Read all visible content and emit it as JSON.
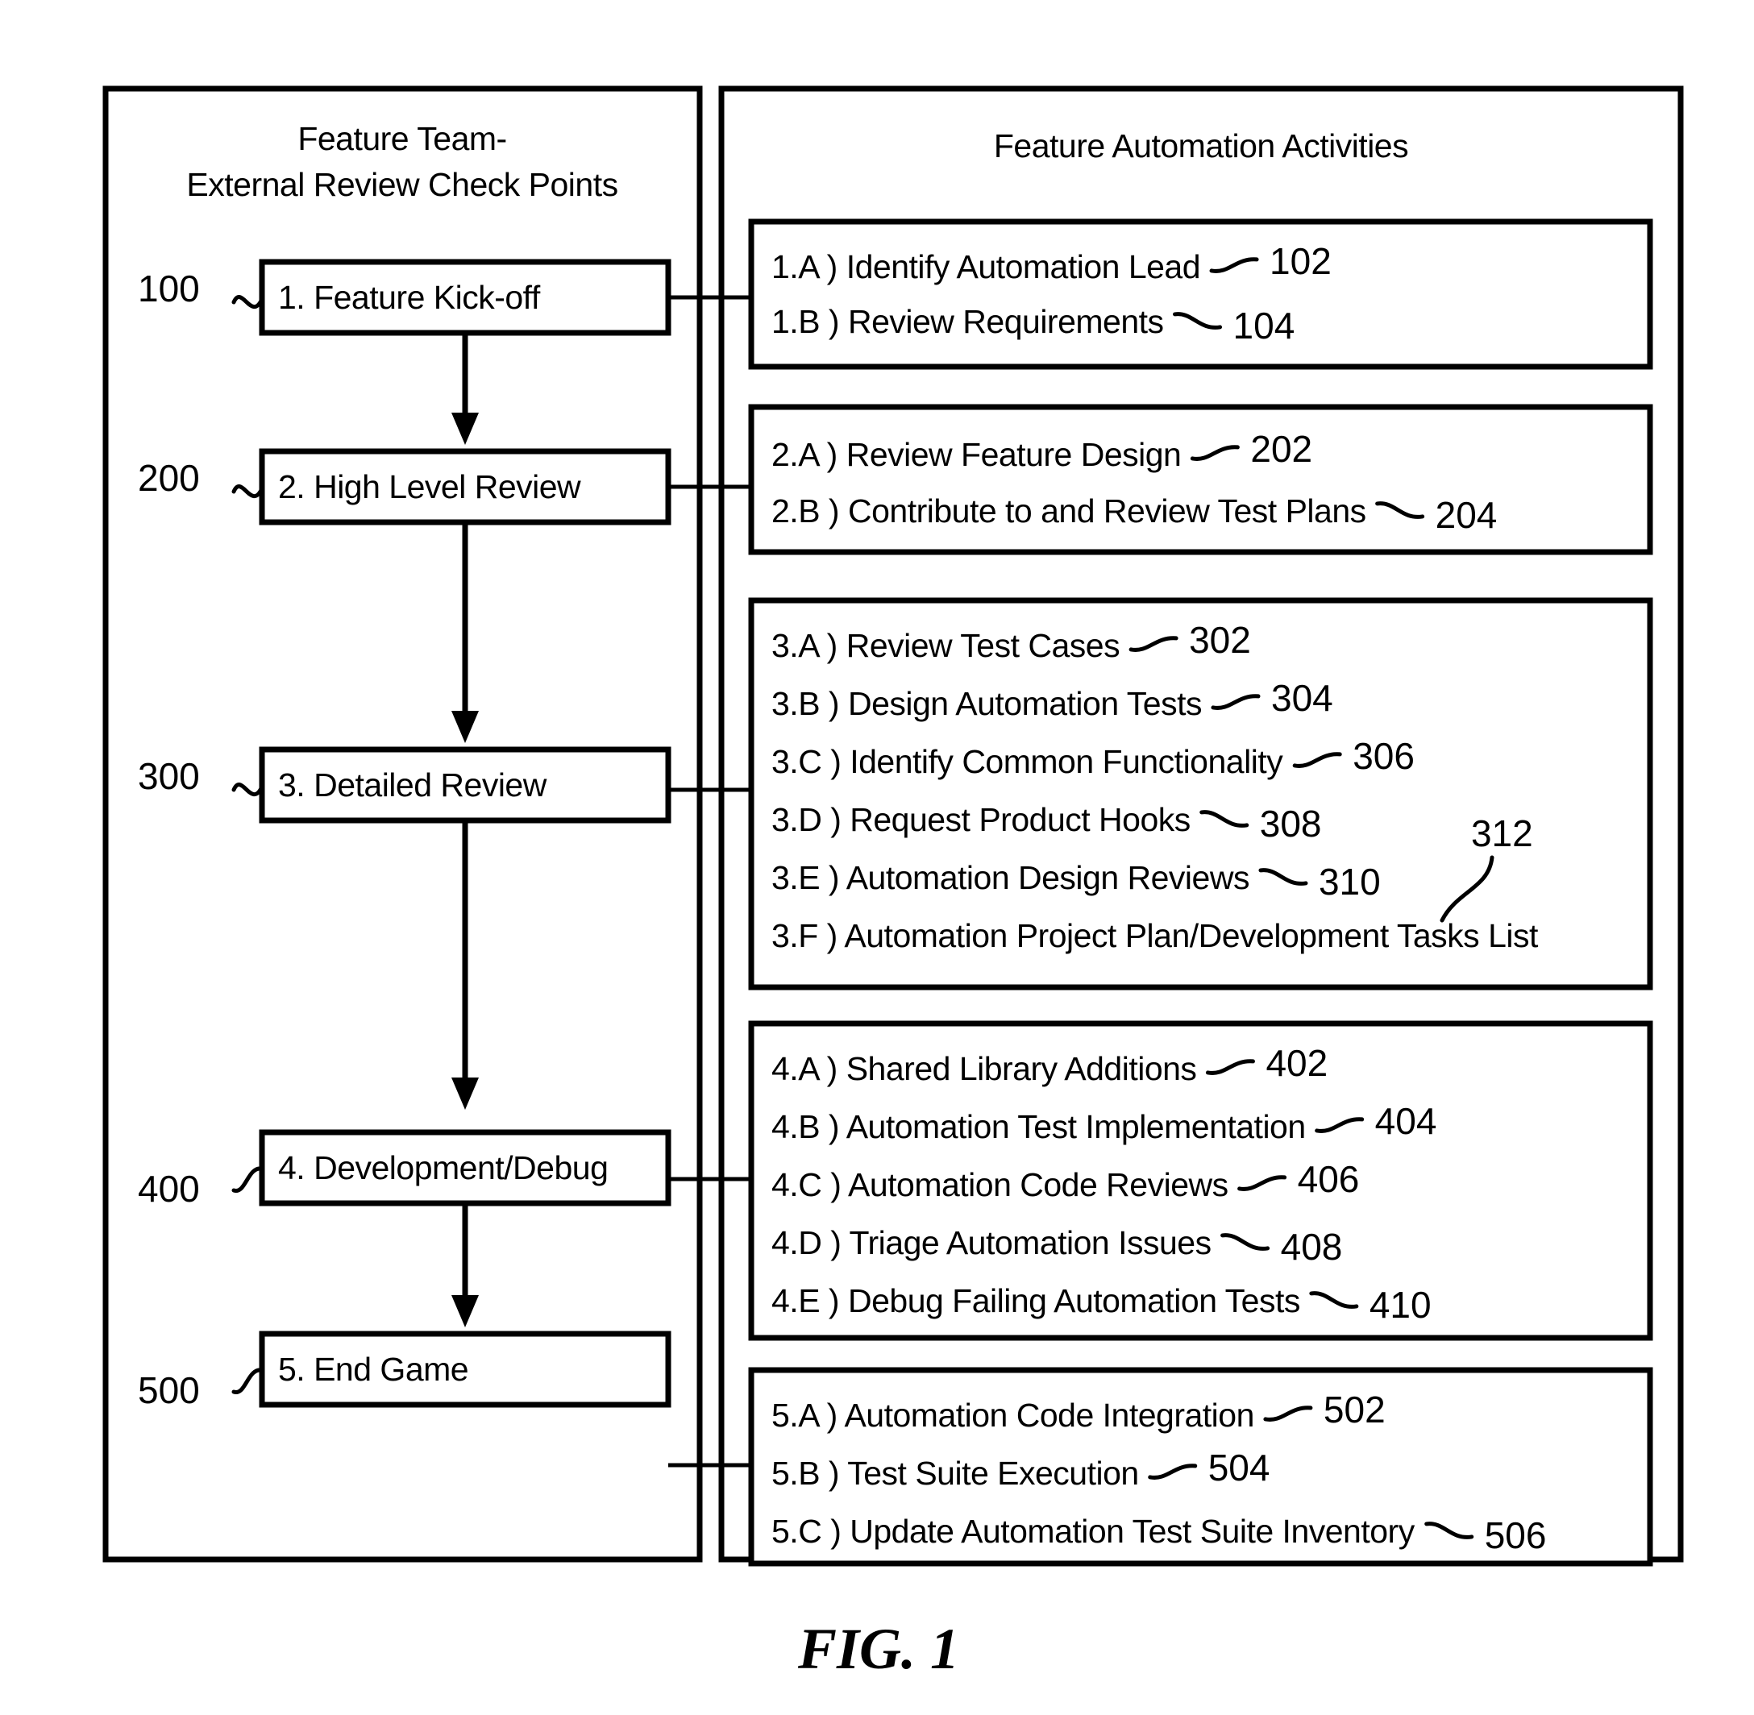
{
  "figure": {
    "caption": "FIG. 1"
  },
  "left_panel": {
    "title_line1": "Feature Team-",
    "title_line2": "External Review Check Points",
    "steps": [
      {
        "ref": "100",
        "label": "1. Feature Kick-off"
      },
      {
        "ref": "200",
        "label": "2. High Level Review"
      },
      {
        "ref": "300",
        "label": "3. Detailed Review"
      },
      {
        "ref": "400",
        "label": "4. Development/Debug"
      },
      {
        "ref": "500",
        "label": "5. End Game"
      }
    ]
  },
  "right_panel": {
    "title": "Feature Automation Activities",
    "groups": [
      {
        "group_id": "1",
        "items": [
          {
            "label": "1.A ) Identify Automation Lead",
            "ref": "102"
          },
          {
            "label": "1.B ) Review Requirements",
            "ref": "104"
          }
        ]
      },
      {
        "group_id": "2",
        "items": [
          {
            "label": "2.A ) Review Feature Design",
            "ref": "202"
          },
          {
            "label": "2.B ) Contribute to and Review Test Plans",
            "ref": "204"
          }
        ]
      },
      {
        "group_id": "3",
        "items": [
          {
            "label": "3.A ) Review Test Cases",
            "ref": "302"
          },
          {
            "label": "3.B ) Design Automation Tests",
            "ref": "304"
          },
          {
            "label": "3.C ) Identify Common Functionality",
            "ref": "306"
          },
          {
            "label": "3.D ) Request Product Hooks",
            "ref": "308"
          },
          {
            "label": "3.E ) Automation Design Reviews",
            "ref": "310"
          },
          {
            "label": "3.F ) Automation Project Plan/Development Tasks List",
            "ref": "312"
          }
        ]
      },
      {
        "group_id": "4",
        "items": [
          {
            "label": "4.A ) Shared Library Additions",
            "ref": "402"
          },
          {
            "label": "4.B ) Automation Test Implementation",
            "ref": "404"
          },
          {
            "label": "4.C ) Automation Code Reviews",
            "ref": "406"
          },
          {
            "label": "4.D ) Triage Automation Issues",
            "ref": "408"
          },
          {
            "label": "4.E ) Debug Failing Automation Tests",
            "ref": "410"
          }
        ]
      },
      {
        "group_id": "5",
        "items": [
          {
            "label": "5.A ) Automation Code Integration",
            "ref": "502"
          },
          {
            "label": "5.B ) Test Suite Execution",
            "ref": "504"
          },
          {
            "label": "5.C ) Update Automation Test Suite Inventory",
            "ref": "506"
          }
        ]
      }
    ]
  },
  "colors": {
    "ink": "#000000",
    "paper": "#ffffff"
  }
}
